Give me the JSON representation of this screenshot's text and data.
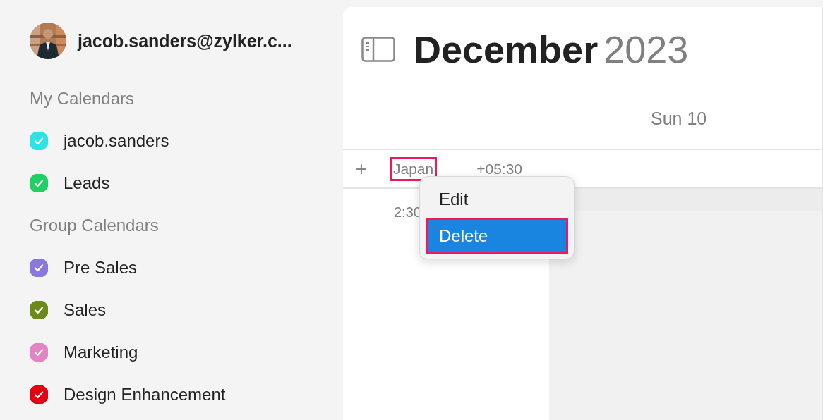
{
  "account": {
    "email": "jacob.sanders@zylker.c..."
  },
  "calendar_groups": [
    {
      "title": "My Calendars",
      "items": [
        {
          "name": "jacob.sanders",
          "checked": true,
          "color": "#2ee3e6"
        },
        {
          "name": "Leads",
          "checked": true,
          "color": "#1fd162"
        }
      ]
    },
    {
      "title": "Group Calendars",
      "items": [
        {
          "name": "Pre Sales",
          "checked": true,
          "color": "#8878e0"
        },
        {
          "name": "Sales",
          "checked": true,
          "color": "#6b8a1a"
        },
        {
          "name": "Marketing",
          "checked": true,
          "color": "#e384c4"
        },
        {
          "name": "Design Enhancement",
          "checked": true,
          "color": "#e60012"
        }
      ]
    }
  ],
  "header": {
    "month": "December",
    "year": "2023"
  },
  "day_column": {
    "label": "Sun 10"
  },
  "timezone": {
    "add": "+",
    "name": "Japan",
    "offset": "+05:30",
    "highlighted": true
  },
  "time_label": "2:30",
  "context_menu": [
    {
      "label": "Edit",
      "selected": false,
      "highlighted": false
    },
    {
      "label": "Delete",
      "selected": true,
      "highlighted": true
    }
  ]
}
